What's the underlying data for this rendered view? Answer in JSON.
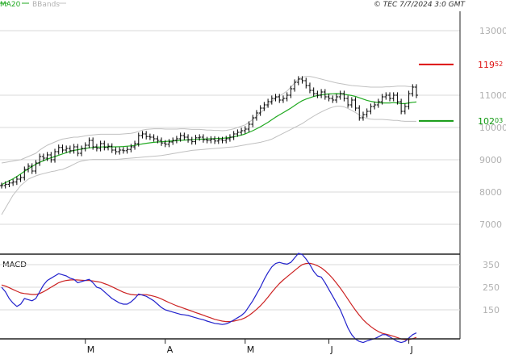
{
  "header": {
    "legend_ma": "MA20",
    "legend_bb": "BBands",
    "timestamp": "© TEC 7/7/2024 3:0 GMT"
  },
  "colors": {
    "ma": "#22aa22",
    "bbands": "#c0c0c0",
    "price": "#000000",
    "resistance": "#dd1111",
    "support": "#119911",
    "macd_line": "#2222cc",
    "signal_line": "#cc2222",
    "grid": "#d8d8d8",
    "axis": "#222222",
    "tick": "#b0b0b0"
  },
  "chart_data": [
    {
      "type": "line",
      "subtype": "ohlc",
      "panel": "price",
      "yticks": [
        "13000",
        "11000",
        "10000",
        "9000",
        "8000",
        "7000"
      ],
      "ylim": [
        6000,
        13500
      ],
      "resistance": {
        "value": 11952,
        "label_main": "119",
        "label_sup": "52"
      },
      "support": {
        "value": 10203,
        "label_main": "102",
        "label_sup": "03"
      },
      "x_labels": [
        "M",
        "A",
        "M",
        "J",
        "J"
      ],
      "n_bars": 110,
      "x_label_bars": [
        22,
        43,
        64,
        86,
        107
      ],
      "close": [
        8200,
        8240,
        8280,
        8310,
        8400,
        8450,
        8700,
        8800,
        8650,
        8900,
        9100,
        9050,
        9150,
        9000,
        9250,
        9380,
        9300,
        9350,
        9280,
        9400,
        9200,
        9350,
        9450,
        9600,
        9400,
        9350,
        9500,
        9380,
        9420,
        9300,
        9250,
        9300,
        9280,
        9320,
        9400,
        9500,
        9750,
        9800,
        9720,
        9700,
        9650,
        9600,
        9520,
        9480,
        9550,
        9600,
        9650,
        9750,
        9700,
        9620,
        9560,
        9680,
        9700,
        9620,
        9600,
        9640,
        9580,
        9620,
        9600,
        9650,
        9700,
        9800,
        9850,
        9900,
        9950,
        10100,
        10300,
        10450,
        10600,
        10700,
        10800,
        10900,
        10950,
        10850,
        10900,
        11000,
        11200,
        11400,
        11500,
        11450,
        11300,
        11150,
        11050,
        11000,
        11100,
        10950,
        10900,
        10850,
        10950,
        11050,
        10900,
        10700,
        10850,
        10600,
        10300,
        10400,
        10500,
        10650,
        10700,
        10800,
        10950,
        11000,
        10900,
        11000,
        10800,
        10500,
        10650,
        11050,
        11250,
        11000
      ],
      "ma20": [
        8230,
        8290,
        8350,
        8410,
        8480,
        8560,
        8640,
        8720,
        8790,
        8860,
        8920,
        8970,
        9020,
        9060,
        9100,
        9140,
        9180,
        9220,
        9260,
        9290,
        9310,
        9330,
        9350,
        9370,
        9380,
        9390,
        9395,
        9400,
        9400,
        9400,
        9400,
        9405,
        9410,
        9420,
        9430,
        9445,
        9470,
        9490,
        9510,
        9525,
        9540,
        9550,
        9560,
        9565,
        9575,
        9585,
        9590,
        9600,
        9610,
        9615,
        9620,
        9630,
        9635,
        9640,
        9645,
        9650,
        9655,
        9660,
        9665,
        9675,
        9690,
        9710,
        9735,
        9765,
        9800,
        9850,
        9900,
        9960,
        10020,
        10090,
        10160,
        10240,
        10320,
        10390,
        10460,
        10530,
        10600,
        10680,
        10760,
        10830,
        10880,
        10920,
        10960,
        10990,
        11010,
        11030,
        11040,
        11045,
        11050,
        11045,
        11030,
        11010,
        10990,
        10960,
        10920,
        10880,
        10840,
        10810,
        10790,
        10770,
        10760,
        10760,
        10760,
        10770,
        10760,
        10740,
        10740,
        10760,
        10780,
        10790
      ],
      "bb_upper": [
        8900,
        8920,
        8940,
        8960,
        8980,
        9000,
        9050,
        9100,
        9150,
        9200,
        9300,
        9380,
        9450,
        9500,
        9550,
        9600,
        9640,
        9660,
        9680,
        9700,
        9700,
        9720,
        9740,
        9760,
        9770,
        9780,
        9790,
        9790,
        9790,
        9790,
        9790,
        9790,
        9800,
        9810,
        9820,
        9840,
        9880,
        9920,
        9940,
        9950,
        9960,
        9960,
        9960,
        9950,
        9950,
        9950,
        9950,
        9960,
        9960,
        9950,
        9940,
        9940,
        9940,
        9930,
        9920,
        9920,
        9910,
        9910,
        9900,
        9910,
        9930,
        9960,
        10000,
        10040,
        10080,
        10160,
        10250,
        10350,
        10450,
        10560,
        10680,
        10800,
        10900,
        10980,
        11050,
        11130,
        11250,
        11380,
        11500,
        11560,
        11580,
        11580,
        11560,
        11530,
        11500,
        11470,
        11440,
        11410,
        11380,
        11360,
        11340,
        11320,
        11300,
        11290,
        11280,
        11270,
        11260,
        11250,
        11250,
        11250,
        11250,
        11260,
        11260,
        11270,
        11280,
        11280,
        11280,
        11270,
        11260,
        11250
      ],
      "bb_lower": [
        7300,
        7500,
        7700,
        7900,
        8050,
        8200,
        8300,
        8400,
        8450,
        8500,
        8540,
        8570,
        8600,
        8630,
        8650,
        8680,
        8700,
        8750,
        8800,
        8860,
        8920,
        8960,
        8980,
        9000,
        9010,
        9010,
        9010,
        9010,
        9010,
        9010,
        9010,
        9020,
        9030,
        9040,
        9050,
        9060,
        9070,
        9080,
        9090,
        9100,
        9110,
        9120,
        9130,
        9150,
        9170,
        9190,
        9210,
        9230,
        9250,
        9270,
        9290,
        9300,
        9310,
        9320,
        9330,
        9340,
        9350,
        9360,
        9370,
        9380,
        9390,
        9400,
        9420,
        9440,
        9460,
        9480,
        9500,
        9520,
        9540,
        9570,
        9600,
        9640,
        9700,
        9760,
        9820,
        9880,
        9940,
        10000,
        10060,
        10120,
        10200,
        10280,
        10350,
        10420,
        10480,
        10540,
        10590,
        10630,
        10660,
        10660,
        10640,
        10590,
        10530,
        10460,
        10390,
        10320,
        10280,
        10260,
        10250,
        10250,
        10250,
        10240,
        10230,
        10220,
        10220,
        10200,
        10190,
        10190,
        10190,
        10190
      ]
    },
    {
      "type": "line",
      "panel": "macd",
      "title": "MACD",
      "yticks": [
        "350",
        "250",
        "150"
      ],
      "ylim": [
        -50,
        450
      ],
      "macd": [
        250,
        230,
        200,
        180,
        165,
        175,
        200,
        195,
        190,
        200,
        230,
        260,
        280,
        290,
        300,
        310,
        305,
        300,
        290,
        285,
        270,
        275,
        280,
        285,
        270,
        250,
        245,
        230,
        215,
        200,
        190,
        180,
        175,
        175,
        185,
        200,
        220,
        215,
        210,
        200,
        190,
        175,
        160,
        150,
        145,
        140,
        135,
        130,
        128,
        125,
        120,
        115,
        110,
        106,
        100,
        95,
        90,
        88,
        85,
        88,
        95,
        105,
        115,
        125,
        140,
        165,
        190,
        220,
        250,
        285,
        315,
        340,
        355,
        360,
        355,
        352,
        360,
        380,
        400,
        395,
        375,
        350,
        320,
        300,
        295,
        270,
        240,
        210,
        180,
        150,
        110,
        70,
        40,
        20,
        10,
        5,
        12,
        18,
        22,
        30,
        40,
        40,
        30,
        20,
        10,
        5,
        10,
        25,
        40,
        48
      ],
      "signal": [
        260,
        255,
        248,
        240,
        232,
        225,
        222,
        220,
        218,
        218,
        222,
        230,
        240,
        250,
        260,
        270,
        276,
        280,
        282,
        283,
        282,
        281,
        280,
        280,
        278,
        275,
        272,
        266,
        260,
        252,
        244,
        236,
        228,
        222,
        218,
        216,
        216,
        217,
        217,
        214,
        210,
        205,
        198,
        190,
        182,
        175,
        168,
        162,
        156,
        150,
        144,
        138,
        132,
        126,
        120,
        114,
        108,
        104,
        100,
        98,
        98,
        100,
        104,
        108,
        115,
        125,
        138,
        152,
        168,
        186,
        206,
        228,
        248,
        266,
        282,
        296,
        310,
        324,
        338,
        350,
        355,
        356,
        352,
        345,
        336,
        323,
        307,
        289,
        268,
        246,
        222,
        197,
        172,
        148,
        126,
        106,
        90,
        76,
        64,
        54,
        46,
        42,
        38,
        33,
        27,
        21,
        18,
        18,
        22,
        28
      ]
    }
  ]
}
